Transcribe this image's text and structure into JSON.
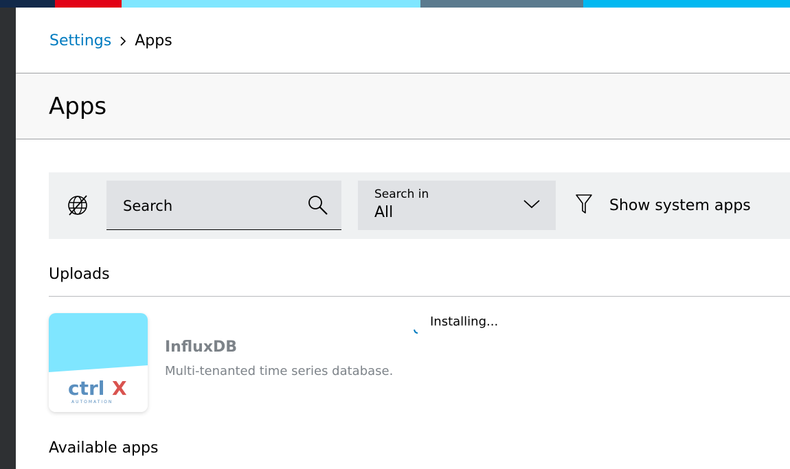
{
  "breadcrumb": {
    "parent": "Settings",
    "current": "Apps"
  },
  "page": {
    "title": "Apps"
  },
  "toolbar": {
    "search_placeholder": "Search",
    "search_in_label": "Search in",
    "search_in_value": "All",
    "show_system_apps_label": "Show system apps"
  },
  "sections": {
    "uploads": "Uploads",
    "available": "Available apps"
  },
  "upload_item": {
    "name": "InfluxDB",
    "description": "Multi-tenanted time series database.",
    "status": "Installing...",
    "logo_text": "ctrlX",
    "logo_sub": "AUTOMATION"
  },
  "colors": {
    "link": "#007bc0",
    "accent_cyan": "#7fe6ff",
    "app_text": "#7d8389",
    "logo_blue": "#5a8fbf",
    "logo_red": "#d9534f",
    "top_strip": [
      "#12294a",
      "#e20015",
      "#7fe6ff",
      "#5a7a8e",
      "#00b8f1"
    ]
  },
  "icons": {
    "breadcrumb_sep": "chevron-right-icon",
    "globe": "globe-off-icon",
    "search": "search-icon",
    "dropdown": "chevron-down-icon",
    "filter": "filter-icon"
  }
}
